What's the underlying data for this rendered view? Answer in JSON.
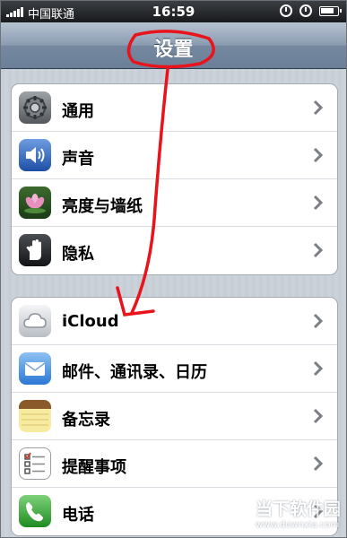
{
  "statusbar": {
    "carrier": "中国联通",
    "time": "16:59"
  },
  "navbar": {
    "title": "设置"
  },
  "groups": [
    {
      "items": [
        {
          "label": "通用",
          "icon": "gear-icon"
        },
        {
          "label": "声音",
          "icon": "speaker-icon"
        },
        {
          "label": "亮度与墙纸",
          "icon": "flower-icon"
        },
        {
          "label": "隐私",
          "icon": "hand-icon"
        }
      ]
    },
    {
      "items": [
        {
          "label": "iCloud",
          "icon": "cloud-icon"
        },
        {
          "label": "邮件、通讯录、日历",
          "icon": "mail-icon"
        },
        {
          "label": "备忘录",
          "icon": "notes-icon"
        },
        {
          "label": "提醒事项",
          "icon": "reminders-icon"
        },
        {
          "label": "电话",
          "icon": "phone-icon"
        }
      ]
    }
  ],
  "watermark": {
    "brand": "当下软件园",
    "url": "www.downxia.com"
  },
  "colors": {
    "annotation": "#e8131b",
    "nav_gradient_top": "#b6c2d0",
    "nav_gradient_bottom": "#6b7f98"
  }
}
